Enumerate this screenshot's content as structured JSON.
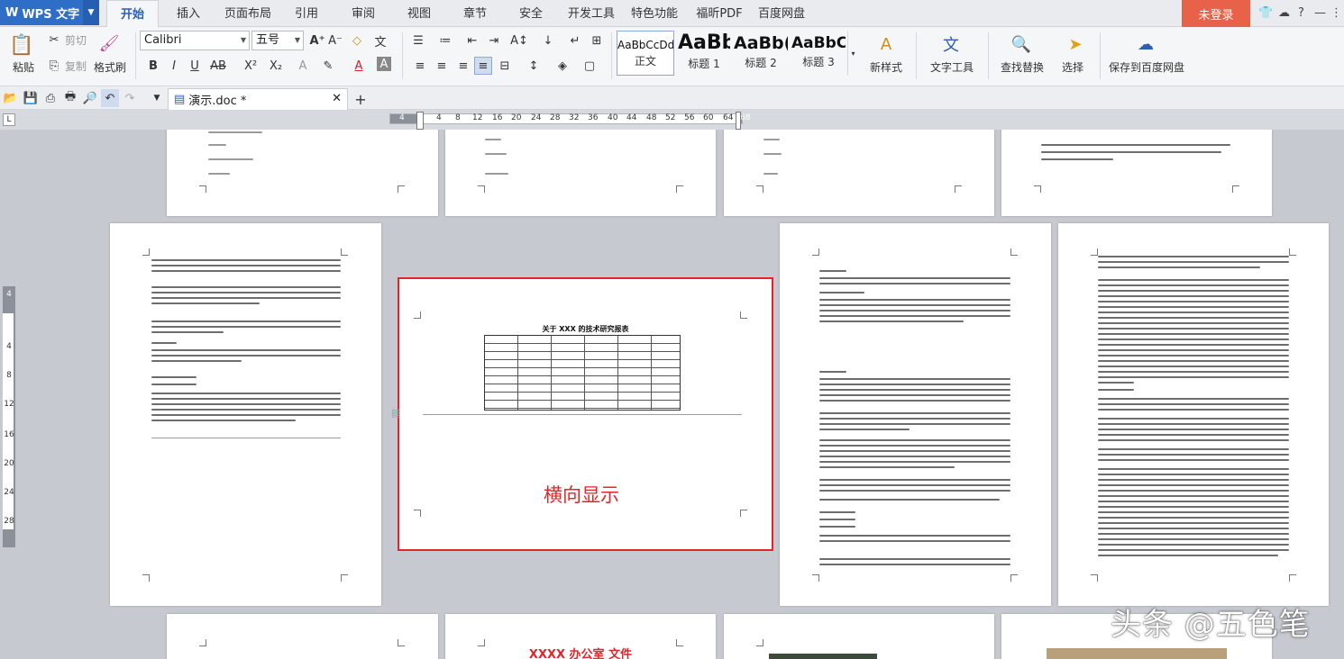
{
  "app": {
    "name": "WPS 文字",
    "login": "未登录"
  },
  "menu": {
    "tabs": [
      "开始",
      "插入",
      "页面布局",
      "引用",
      "审阅",
      "视图",
      "章节",
      "安全",
      "开发工具",
      "特色功能",
      "福昕PDF",
      "百度网盘"
    ],
    "active": "开始"
  },
  "ribbon": {
    "paste": "粘贴",
    "cut": "剪切",
    "copy": "复制",
    "format_painter": "格式刷",
    "font_name": "Calibri",
    "font_size": "五号",
    "styles": [
      {
        "sample": "AaBbCcDd",
        "name": "正文"
      },
      {
        "sample": "AaBb",
        "name": "标题 1"
      },
      {
        "sample": "AaBb(",
        "name": "标题 2"
      },
      {
        "sample": "AaBbC",
        "name": "标题 3"
      }
    ],
    "new_style": "新样式",
    "text_tools": "文字工具",
    "find_replace": "查找替换",
    "select": "选择",
    "save_to_baidu": "保存到百度网盘"
  },
  "document": {
    "tab_name": "演示.doc *"
  },
  "ruler": {
    "ticks": [
      "4",
      "4",
      "8",
      "12",
      "16",
      "20",
      "24",
      "28",
      "32",
      "36",
      "40",
      "44",
      "48",
      "52",
      "56",
      "60",
      "64",
      "68"
    ],
    "vticks": [
      "4",
      "4",
      "8",
      "12",
      "16",
      "20",
      "24",
      "28"
    ]
  },
  "pages": {
    "landscape_title": "关于 XXX 的技术研究报表",
    "landscape_note": "横向显示",
    "office_header": "XXXX 办公室 文件"
  },
  "watermark": "头条 @五色笔"
}
